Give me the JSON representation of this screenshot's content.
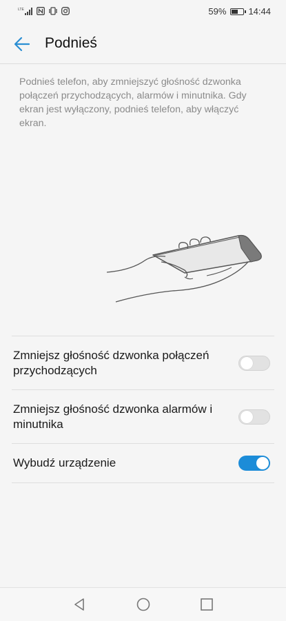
{
  "status_bar": {
    "left_icons": [
      "lte-signal-icon",
      "nfc-icon",
      "vibrate-icon",
      "instagram-icon"
    ],
    "battery_level": 0.59,
    "battery_percent": "59%",
    "time": "14:44"
  },
  "app_bar": {
    "title": "Podnieś",
    "back_icon": "back-arrow-icon",
    "accent_color": "#2a8ed3"
  },
  "description": "Podnieś telefon, aby zmniejszyć głośność dzwonka połączeń przychodzących, alarmów i minutnika. Gdy ekran jest wyłączony, podnieś telefon, aby włączyć ekran.",
  "illustration": "hand-lifting-phone-illustration",
  "settings": [
    {
      "label": "Zmniejsz głośność dzwonka połączeń przychodzących",
      "enabled": false
    },
    {
      "label": "Zmniejsz głośność dzwonka alarmów i minutnika",
      "enabled": false
    },
    {
      "label": "Wybudź urządzenie",
      "enabled": true
    }
  ],
  "toggle_on_color": "#1c8cd8",
  "nav_bar": [
    "back-triangle-icon",
    "home-circle-icon",
    "recents-square-icon"
  ]
}
